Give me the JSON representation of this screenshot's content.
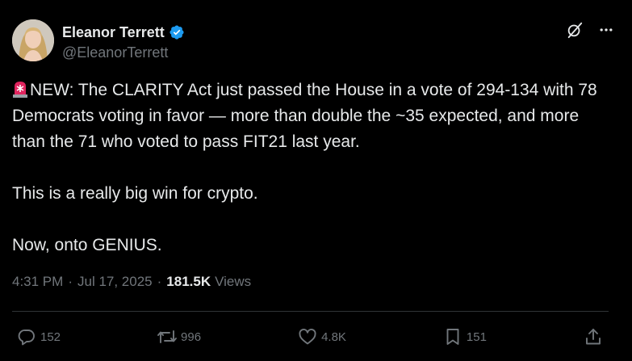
{
  "author": {
    "display_name": "Eleanor Terrett",
    "handle": "@EleanorTerrett",
    "verified_color": "#1d9bf0"
  },
  "tweet": {
    "paragraph_1": "NEW: The CLARITY Act just passed the House in a vote of 294-134 with 78 Democrats voting in favor — more than double the ~35 expected, and more than the 71 who voted to pass FIT21 last year.",
    "paragraph_2": "This is a really big win for crypto.",
    "paragraph_3": "Now, onto GENIUS.",
    "emoji": "rotating-light"
  },
  "meta": {
    "time": "4:31 PM",
    "separator": "·",
    "date": "Jul 17, 2025",
    "views_count": "181.5K",
    "views_label": "Views"
  },
  "actions": {
    "replies": "152",
    "reposts": "996",
    "likes": "4.8K",
    "bookmarks": "151"
  },
  "icons": [
    "grok-icon",
    "more-icon",
    "reply-icon",
    "repost-icon",
    "like-icon",
    "bookmark-icon",
    "share-icon",
    "verified-badge-icon",
    "siren-icon"
  ]
}
